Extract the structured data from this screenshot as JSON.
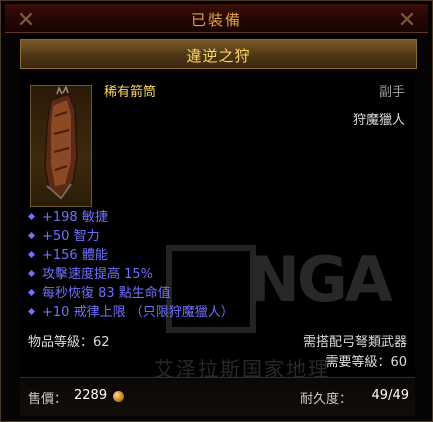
{
  "header": {
    "equipped_label": "已裝備"
  },
  "item": {
    "name": "違逆之狩",
    "type": "稀有箭筒",
    "slot": "副手",
    "class": "狩魔獵人",
    "icon": "quiver-icon",
    "stats": [
      "+198 敏捷",
      "+50 智力",
      "+156 體能",
      "攻擊速度提高 15%",
      "每秒恢復 83 點生命值",
      "+10 戒律上限 （只限狩魔獵人）"
    ],
    "item_level": "物品等級：62",
    "requirement_weapon": "需搭配弓弩類武器",
    "requirement_level": "需要等級：60",
    "sell_label": "售價：",
    "sell_value": "2289",
    "durability_label": "耐久度：",
    "durability_value": "49/49"
  },
  "watermark": {
    "logo": "NGA",
    "caption": "艾泽拉斯国家地理"
  },
  "colors": {
    "rare_name": "#ffd860",
    "magic_stat": "#7070ff",
    "equipped_header": "#e0a040"
  }
}
